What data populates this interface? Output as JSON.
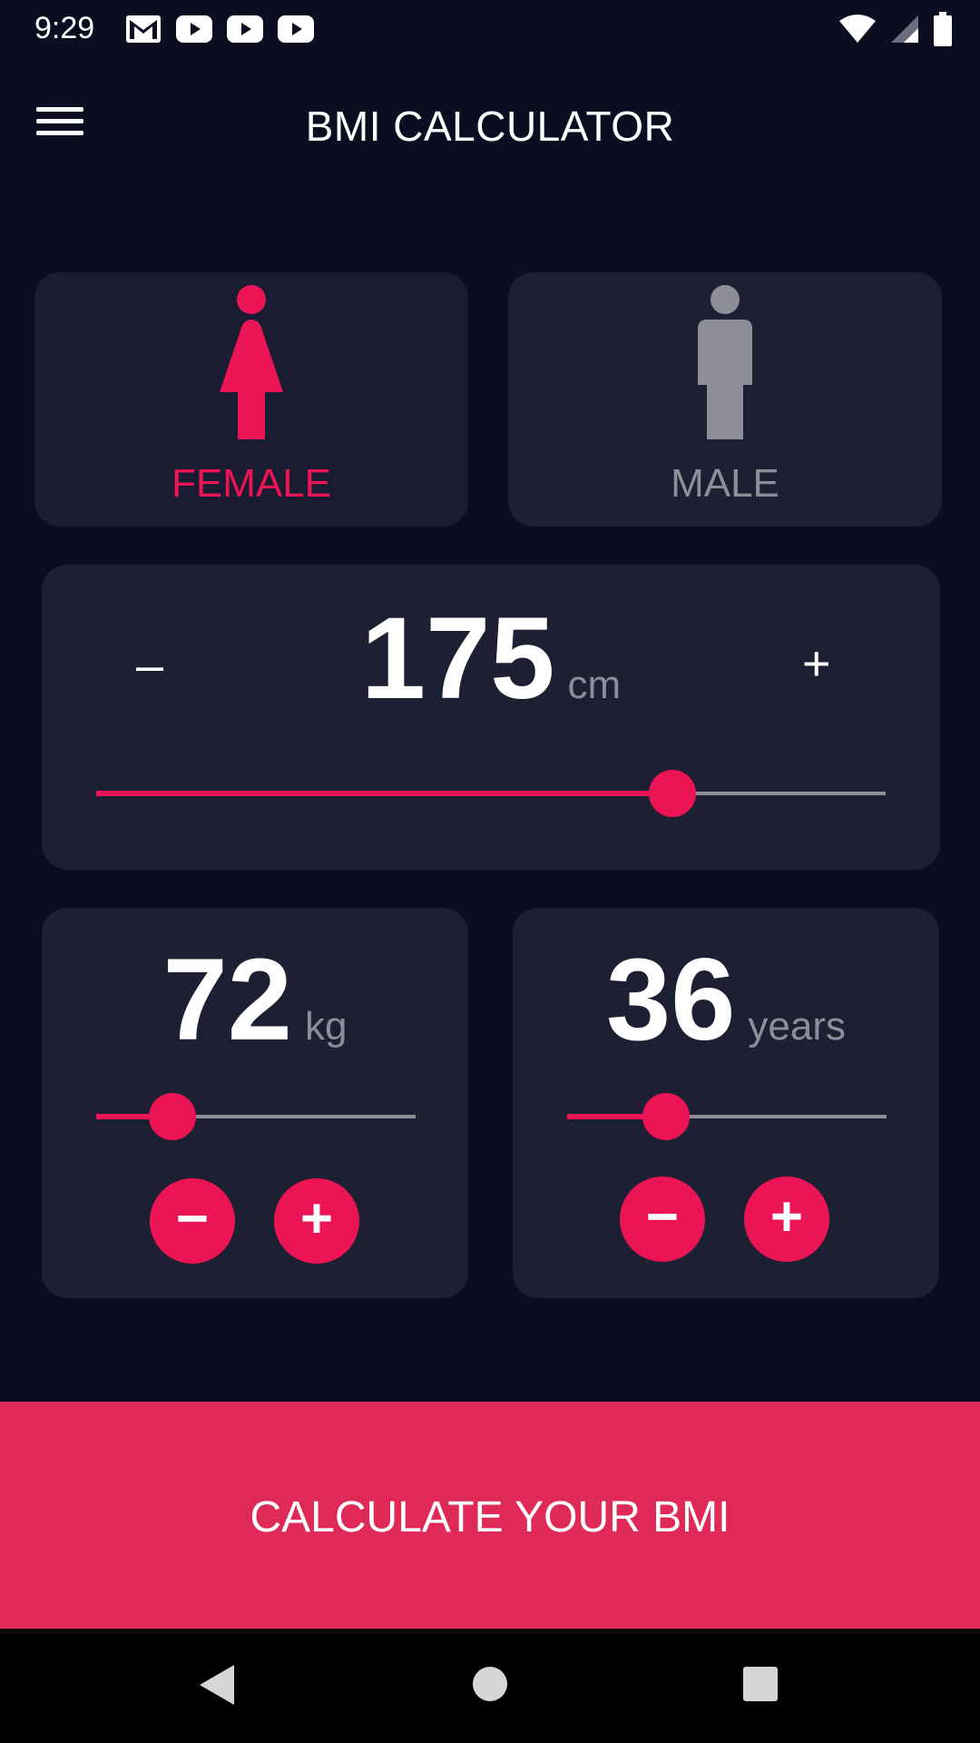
{
  "status_bar": {
    "time": "9:29",
    "left_icons": [
      "gmail-icon",
      "youtube-icon",
      "youtube-icon",
      "youtube-icon"
    ],
    "right_icons": [
      "wifi-icon",
      "signal-icon",
      "battery-icon"
    ]
  },
  "app_bar": {
    "title": "BMI CALCULATOR",
    "menu_icon": "hamburger-menu-icon"
  },
  "gender": {
    "female": {
      "label": "FEMALE",
      "selected": true,
      "icon": "female-icon"
    },
    "male": {
      "label": "MALE",
      "selected": false,
      "icon": "male-icon"
    }
  },
  "height": {
    "value": "175",
    "unit": "cm",
    "minus": "–",
    "plus": "+",
    "slider_fraction": 0.73
  },
  "weight": {
    "value": "72",
    "unit": "kg",
    "minus": "−",
    "plus": "+",
    "slider_fraction": 0.24
  },
  "age": {
    "value": "36",
    "unit": "years",
    "minus": "−",
    "plus": "+",
    "slider_fraction": 0.31
  },
  "calculate_button": {
    "label": "CALCULATE YOUR BMI"
  },
  "nav_bar": {
    "buttons": [
      "back-icon",
      "home-icon",
      "recents-icon"
    ]
  },
  "colors": {
    "background": "#0b0e21",
    "card": "#1d1f33",
    "accent": "#eb1555",
    "button": "#df2957",
    "inactive": "#8d8e98"
  }
}
